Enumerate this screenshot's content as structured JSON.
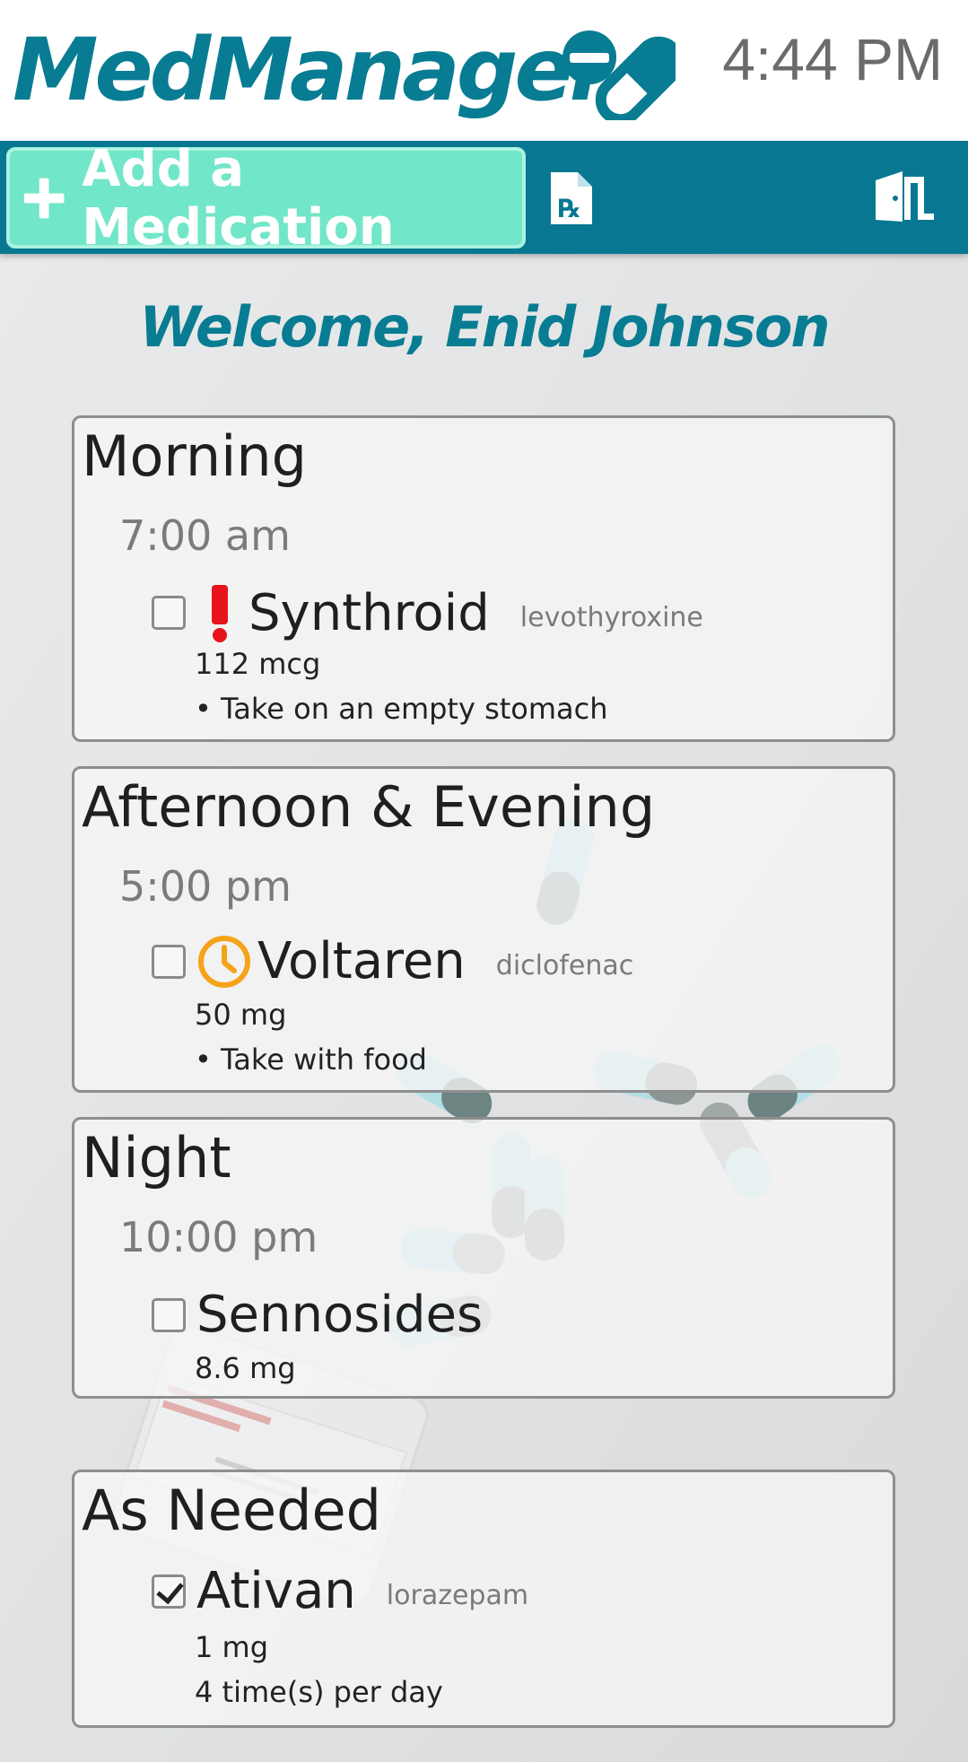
{
  "app": {
    "title": "MedManager",
    "time": "4:44 PM"
  },
  "toolbar": {
    "add_label": "Add a Medication"
  },
  "welcome": "Welcome, Enid Johnson",
  "colors": {
    "brand": "#087c92",
    "toolbar": "#087892",
    "add_button": "#72e6c8",
    "alert": "#e8141b",
    "clock_icon": "#f5a31a"
  },
  "icons": {
    "logo": "pill-icon",
    "add": "plus-icon",
    "prescription": "prescription-icon",
    "logout": "exit-door-icon"
  },
  "schedule": {
    "morning": {
      "title": "Morning",
      "time": "7:00 am",
      "meds": [
        {
          "name": "Synthroid",
          "generic": "levothyroxine",
          "dose": "112 mcg",
          "note": "• Take on an empty stomach",
          "checked": false,
          "icon": "exclamation-icon"
        }
      ]
    },
    "afternoon": {
      "title": "Afternoon & Evening",
      "time": "5:00 pm",
      "meds": [
        {
          "name": "Voltaren",
          "generic": "diclofenac",
          "dose": "50 mg",
          "note": "• Take with food",
          "checked": false,
          "icon": "clock-icon"
        }
      ]
    },
    "night": {
      "title": "Night",
      "time": "10:00 pm",
      "meds": [
        {
          "name": "Sennosides",
          "dose": "8.6 mg",
          "checked": false
        }
      ]
    },
    "as_needed": {
      "title": "As Needed",
      "meds": [
        {
          "name": "Ativan",
          "generic": "lorazepam",
          "dose": "1 mg",
          "frequency": "4 time(s) per day",
          "checked": true
        }
      ]
    }
  }
}
